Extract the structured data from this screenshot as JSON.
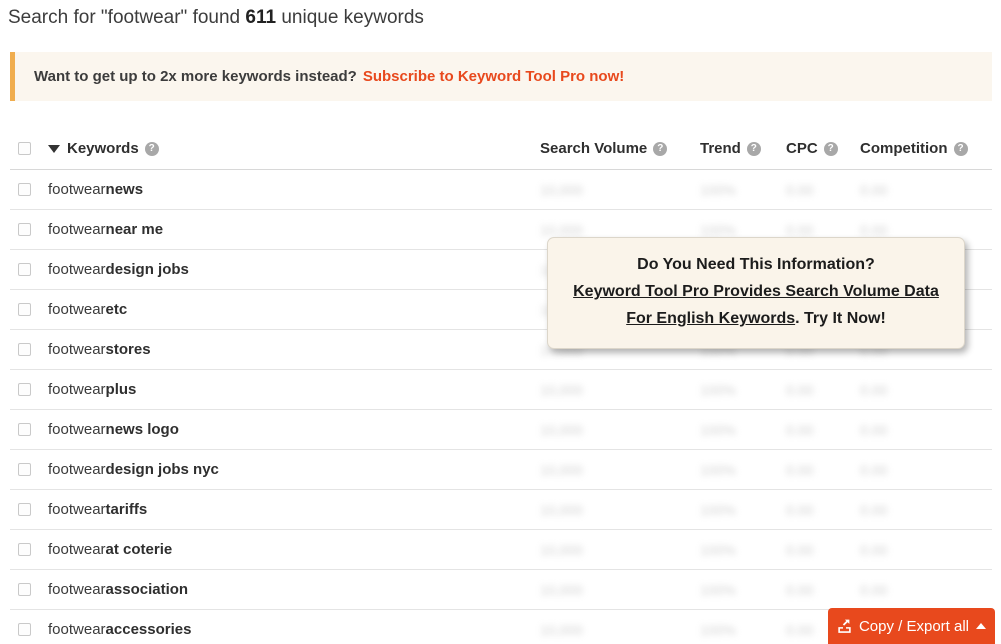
{
  "page": {
    "title_prefix": "Search for \"footwear\" found ",
    "title_count": "611",
    "title_suffix": " unique keywords"
  },
  "promo_banner": {
    "message": "Want to get up to 2x more keywords instead?",
    "link_label": "Subscribe to Keyword Tool Pro now!",
    "accent_color": "#f0ad4e",
    "background_color": "#fbf6ee",
    "link_color": "#e8491d"
  },
  "table": {
    "columns": [
      {
        "label": "Keywords",
        "help": "?"
      },
      {
        "label": "Search Volume",
        "help": "?"
      },
      {
        "label": "Trend",
        "help": "?"
      },
      {
        "label": "CPC",
        "help": "?"
      },
      {
        "label": "Competition",
        "help": "?"
      }
    ],
    "sort_indicator": "chevron-down",
    "rows": [
      {
        "seed": "footwear ",
        "tail": "news",
        "volume": "10,000",
        "trend": "100%",
        "cpc": "0.00",
        "competition": "0.00"
      },
      {
        "seed": "footwear ",
        "tail": "near me",
        "volume": "10,000",
        "trend": "100%",
        "cpc": "0.00",
        "competition": "0.00"
      },
      {
        "seed": "footwear ",
        "tail": "design jobs",
        "volume": "10,000",
        "trend": "100%",
        "cpc": "0.00",
        "competition": "0.00"
      },
      {
        "seed": "footwear ",
        "tail": "etc",
        "volume": "10,000",
        "trend": "100%",
        "cpc": "0.00",
        "competition": "0.00"
      },
      {
        "seed": "footwear ",
        "tail": "stores",
        "volume": "10,000",
        "trend": "100%",
        "cpc": "0.00",
        "competition": "0.00"
      },
      {
        "seed": "footwear ",
        "tail": "plus",
        "volume": "10,000",
        "trend": "100%",
        "cpc": "0.00",
        "competition": "0.00"
      },
      {
        "seed": "footwear ",
        "tail": "news logo",
        "volume": "10,000",
        "trend": "100%",
        "cpc": "0.00",
        "competition": "0.00"
      },
      {
        "seed": "footwear ",
        "tail": "design jobs nyc",
        "volume": "10,000",
        "trend": "100%",
        "cpc": "0.00",
        "competition": "0.00"
      },
      {
        "seed": "footwear ",
        "tail": "tariffs",
        "volume": "10,000",
        "trend": "100%",
        "cpc": "0.00",
        "competition": "0.00"
      },
      {
        "seed": "footwear ",
        "tail": "at coterie",
        "volume": "10,000",
        "trend": "100%",
        "cpc": "0.00",
        "competition": "0.00"
      },
      {
        "seed": "footwear ",
        "tail": "association",
        "volume": "10,000",
        "trend": "100%",
        "cpc": "0.00",
        "competition": "0.00"
      },
      {
        "seed": "footwear ",
        "tail": "accessories",
        "volume": "10,000",
        "trend": "100%",
        "cpc": "0.00",
        "competition": "0.00"
      }
    ]
  },
  "info_popup": {
    "heading": "Do You Need This Information?",
    "link_text": "Keyword Tool Pro Provides Search Volume Data For English Keywords",
    "trailing_text": ". Try It Now!"
  },
  "export_button": {
    "label": "Copy / Export all",
    "icon": "export-icon",
    "caret": "chevron-up",
    "color": "#e8491d"
  }
}
